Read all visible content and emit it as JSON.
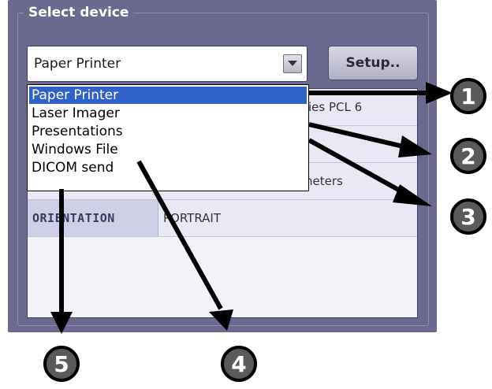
{
  "group": {
    "title": "Select device"
  },
  "combo": {
    "value": "Paper Printer"
  },
  "setup_button": {
    "label": "Setup.."
  },
  "dropdown": {
    "items": [
      {
        "label": "Paper Printer",
        "selected": true
      },
      {
        "label": "Laser Imager",
        "selected": false
      },
      {
        "label": "Presentations",
        "selected": false
      },
      {
        "label": "Windows File",
        "selected": false
      },
      {
        "label": "DICOM send",
        "selected": false
      }
    ]
  },
  "info": {
    "row1_partial": "ies PCL 6",
    "row3_partial": "neters",
    "orientation_label": "ORIENTATION",
    "orientation_value": "PORTRAIT"
  },
  "callouts": [
    "1",
    "2",
    "3",
    "4",
    "5"
  ]
}
